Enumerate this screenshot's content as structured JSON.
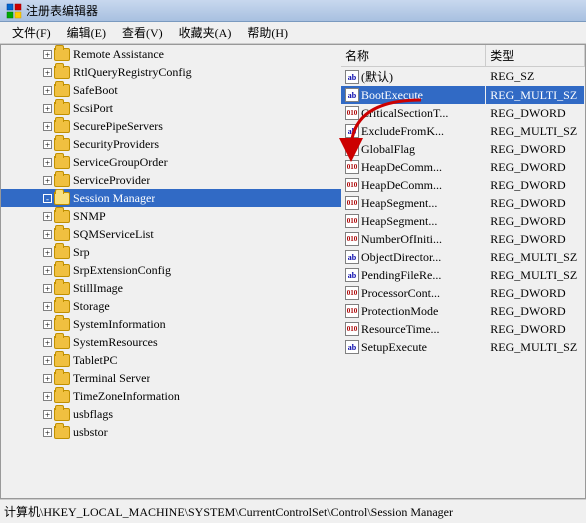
{
  "titleBar": {
    "text": "注册表编辑器",
    "icon": "regedit"
  },
  "menuBar": {
    "items": [
      {
        "label": "文件(F)"
      },
      {
        "label": "编辑(E)"
      },
      {
        "label": "查看(V)"
      },
      {
        "label": "收藏夹(A)"
      },
      {
        "label": "帮助(H)"
      }
    ]
  },
  "tree": {
    "items": [
      {
        "label": "Remote Assistance",
        "indent": 2,
        "type": "folder",
        "expanded": false
      },
      {
        "label": "RtlQueryRegistryConfig",
        "indent": 2,
        "type": "folder",
        "expanded": false
      },
      {
        "label": "SafeBoot",
        "indent": 2,
        "type": "folder",
        "expanded": false
      },
      {
        "label": "ScsiPort",
        "indent": 2,
        "type": "folder",
        "expanded": false
      },
      {
        "label": "SecurePipeServers",
        "indent": 2,
        "type": "folder",
        "expanded": false
      },
      {
        "label": "SecurityProviders",
        "indent": 2,
        "type": "folder",
        "expanded": false
      },
      {
        "label": "ServiceGroupOrder",
        "indent": 2,
        "type": "folder",
        "expanded": false
      },
      {
        "label": "ServiceProvider",
        "indent": 2,
        "type": "folder",
        "expanded": false
      },
      {
        "label": "Session Manager",
        "indent": 2,
        "type": "folder",
        "expanded": true,
        "selected": true
      },
      {
        "label": "SNMP",
        "indent": 2,
        "type": "folder",
        "expanded": false
      },
      {
        "label": "SQMServiceList",
        "indent": 2,
        "type": "folder",
        "expanded": false
      },
      {
        "label": "Srp",
        "indent": 2,
        "type": "folder",
        "expanded": false
      },
      {
        "label": "SrpExtensionConfig",
        "indent": 2,
        "type": "folder",
        "expanded": false
      },
      {
        "label": "StillImage",
        "indent": 2,
        "type": "folder",
        "expanded": false
      },
      {
        "label": "Storage",
        "indent": 2,
        "type": "folder",
        "expanded": false
      },
      {
        "label": "SystemInformation",
        "indent": 2,
        "type": "folder",
        "expanded": false
      },
      {
        "label": "SystemResources",
        "indent": 2,
        "type": "folder",
        "expanded": false
      },
      {
        "label": "TabletPC",
        "indent": 2,
        "type": "folder",
        "expanded": false
      },
      {
        "label": "Terminal Server",
        "indent": 2,
        "type": "folder",
        "expanded": false
      },
      {
        "label": "TimeZoneInformation",
        "indent": 2,
        "type": "folder",
        "expanded": false
      },
      {
        "label": "usbflags",
        "indent": 2,
        "type": "folder",
        "expanded": false
      },
      {
        "label": "usbstor",
        "indent": 2,
        "type": "folder",
        "expanded": false
      }
    ]
  },
  "registry": {
    "columns": [
      {
        "label": "名称"
      },
      {
        "label": "类型"
      }
    ],
    "rows": [
      {
        "name": "(默认)",
        "type": "REG_SZ",
        "iconType": "sz",
        "selected": false
      },
      {
        "name": "BootExecute",
        "type": "REG_MULTI_SZ",
        "iconType": "sz",
        "selected": true
      },
      {
        "name": "CriticalSectionT...",
        "type": "REG_DWORD",
        "iconType": "dword",
        "selected": false
      },
      {
        "name": "ExcludeFromK...",
        "type": "REG_MULTI_SZ",
        "iconType": "sz",
        "selected": false
      },
      {
        "name": "GlobalFlag",
        "type": "REG_DWORD",
        "iconType": "dword",
        "selected": false
      },
      {
        "name": "HeapDeComm...",
        "type": "REG_DWORD",
        "iconType": "dword",
        "selected": false
      },
      {
        "name": "HeapDeComm...",
        "type": "REG_DWORD",
        "iconType": "dword",
        "selected": false
      },
      {
        "name": "HeapSegment...",
        "type": "REG_DWORD",
        "iconType": "dword",
        "selected": false
      },
      {
        "name": "HeapSegment...",
        "type": "REG_DWORD",
        "iconType": "dword",
        "selected": false
      },
      {
        "name": "NumberOfIniti...",
        "type": "REG_DWORD",
        "iconType": "dword",
        "selected": false
      },
      {
        "name": "ObjectDirector...",
        "type": "REG_MULTI_SZ",
        "iconType": "sz",
        "selected": false
      },
      {
        "name": "PendingFileRe...",
        "type": "REG_MULTI_SZ",
        "iconType": "sz",
        "selected": false
      },
      {
        "name": "ProcessorCont...",
        "type": "REG_DWORD",
        "iconType": "dword",
        "selected": false
      },
      {
        "name": "ProtectionMode",
        "type": "REG_DWORD",
        "iconType": "dword",
        "selected": false
      },
      {
        "name": "ResourceTime...",
        "type": "REG_DWORD",
        "iconType": "dword",
        "selected": false
      },
      {
        "name": "SetupExecute",
        "type": "REG_MULTI_SZ",
        "iconType": "sz",
        "selected": false
      }
    ]
  },
  "statusBar": {
    "text": "计算机\\HKEY_LOCAL_MACHINE\\SYSTEM\\CurrentControlSet\\Control\\Session Manager"
  }
}
